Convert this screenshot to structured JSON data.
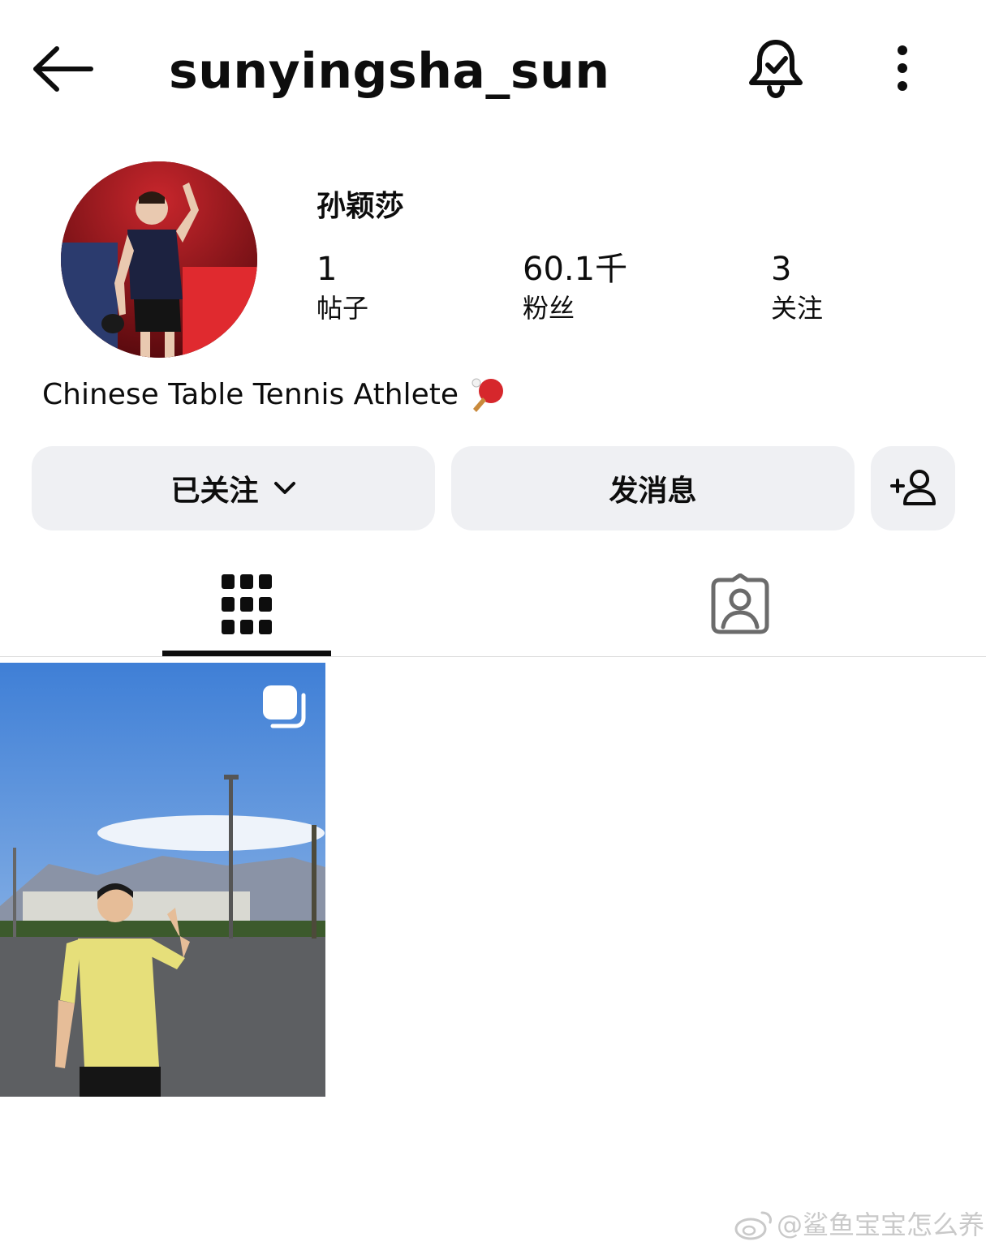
{
  "header": {
    "username": "sunyingsha_sun",
    "back_icon": "arrow-left-icon",
    "bell_icon": "bell-check-icon",
    "more_icon": "more-vertical-icon"
  },
  "profile": {
    "display_name": "孙颖莎",
    "stats": [
      {
        "value": "1",
        "label": "帖子"
      },
      {
        "value": "60.1千",
        "label": "粉丝"
      },
      {
        "value": "3",
        "label": "关注"
      }
    ],
    "bio": "Chinese Table Tennis Athlete",
    "bio_emoji": "ping-pong-paddle-icon"
  },
  "actions": {
    "following_label": "已关注",
    "message_label": "发消息",
    "add_person_icon": "add-person-icon"
  },
  "tabs": [
    {
      "name": "posts-grid",
      "icon": "grid-icon",
      "selected": true
    },
    {
      "name": "tagged",
      "icon": "tagged-person-icon",
      "selected": false
    }
  ],
  "posts": [
    {
      "type": "carousel",
      "icon": "multiple-photos-icon"
    }
  ],
  "watermark": {
    "text": "@鲨鱼宝宝怎么养",
    "icon": "weibo-icon"
  },
  "colors": {
    "button_bg": "#eff0f3",
    "text": "#0d0d0d",
    "divider": "#dbdbdb"
  }
}
